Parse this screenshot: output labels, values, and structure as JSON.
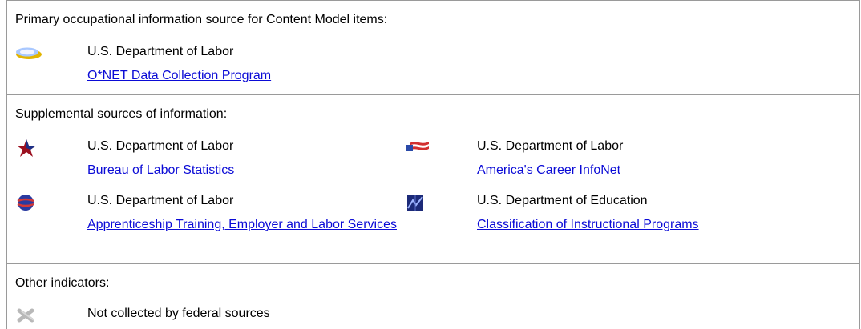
{
  "primary": {
    "heading": "Primary occupational information source for Content Model items:",
    "source": {
      "icon": "onet-oval-icon",
      "agency": "U.S. Department of Labor",
      "link": "O*NET Data Collection Program"
    }
  },
  "supplemental": {
    "heading": "Supplemental sources of information:",
    "sources": [
      {
        "icon": "star-icon",
        "agency": "U.S. Department of Labor",
        "link": "Bureau of Labor Statistics"
      },
      {
        "icon": "flag-icon",
        "agency": "U.S. Department of Labor",
        "link": "America's Career InfoNet"
      },
      {
        "icon": "globe-icon",
        "agency": "U.S. Department of Labor",
        "link": "Apprenticeship Training, Employer and Labor Services"
      },
      {
        "icon": "education-icon",
        "agency": "U.S. Department of Education",
        "link": "Classification of Instructional Programs"
      }
    ]
  },
  "other": {
    "heading": "Other indicators:",
    "indicators": [
      {
        "icon": "not-collected-x-icon",
        "label": "Not collected by federal sources"
      }
    ]
  },
  "colors": {
    "link": "#0b0bd6",
    "border": "#9a9a9a"
  }
}
